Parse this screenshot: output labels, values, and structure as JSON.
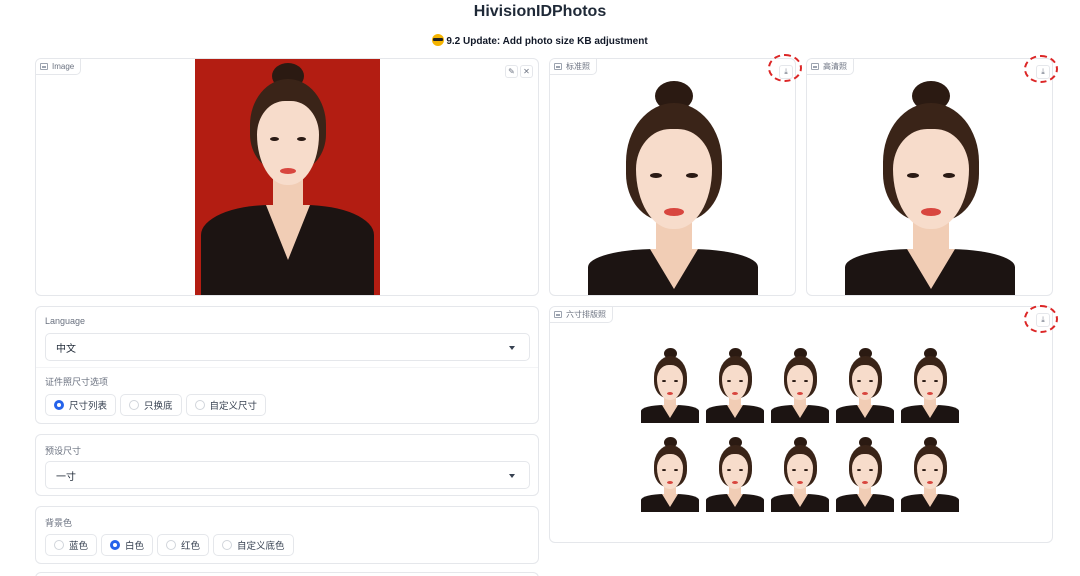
{
  "header": {
    "title": "HivisionIDPhotos",
    "update_text": "9.2 Update: Add photo size KB adjustment"
  },
  "input_image": {
    "label": "Image"
  },
  "outputs": {
    "standard": {
      "label": "标准照"
    },
    "hd": {
      "label": "高清照"
    },
    "layout": {
      "label": "六寸排版照"
    }
  },
  "language": {
    "label": "Language",
    "value": "中文"
  },
  "size_options": {
    "label": "证件照尺寸选项",
    "options": [
      "尺寸列表",
      "只换底",
      "自定义尺寸"
    ],
    "selected": "尺寸列表"
  },
  "preset_size": {
    "label": "预设尺寸",
    "value": "一寸"
  },
  "background": {
    "label": "背景色",
    "options": [
      "蓝色",
      "白色",
      "红色",
      "自定义底色"
    ],
    "selected": "白色"
  },
  "colors": {
    "accent": "#2563eb",
    "highlight": "#dc2626",
    "photo_red": "#b31d12"
  }
}
